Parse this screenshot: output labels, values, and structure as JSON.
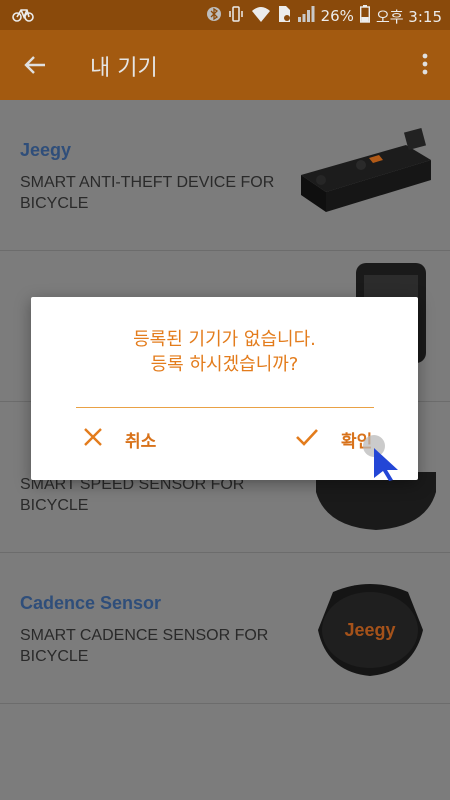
{
  "status_bar": {
    "battery_percent": "26%",
    "time": "오후 3:15"
  },
  "app_bar": {
    "title": "내 기기"
  },
  "devices": [
    {
      "name": "Jeegy",
      "description": "SMART ANTI-THEFT DEVICE FOR BICYCLE"
    },
    {
      "name": "",
      "description": ""
    },
    {
      "name": "",
      "description": "SMART SPEED SENSOR FOR BICYCLE"
    },
    {
      "name": "Cadence Sensor",
      "description": "SMART CADENCE SENSOR FOR BICYCLE",
      "logo": "Jeegy"
    }
  ],
  "dialog": {
    "message_line1": "등록된 기기가 없습니다.",
    "message_line2": "등록 하시겠습니까?",
    "cancel_label": "취소",
    "confirm_label": "확인"
  },
  "colors": {
    "status_bar": "#8a4a0b",
    "app_bar": "#a35a10",
    "accent": "#e37c1c",
    "device_name": "#2f4e7a"
  }
}
